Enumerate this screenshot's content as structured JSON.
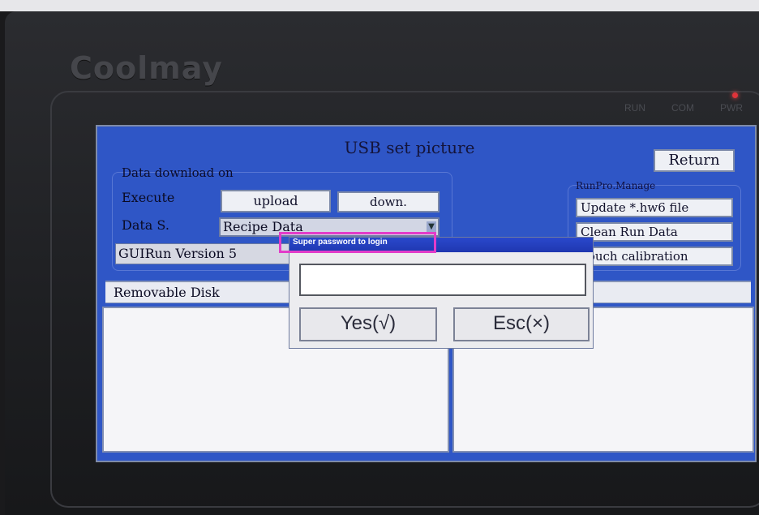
{
  "device": {
    "brand": "Coolmay",
    "leds": [
      "RUN",
      "COM",
      "PWR"
    ]
  },
  "screen": {
    "title": "USB set picture",
    "return_label": "Return",
    "data_group_label": "Data download on",
    "execute_label": "Execute",
    "upload_label": "upload",
    "down_label": "down.",
    "data_source_label": "Data S.",
    "data_source_value": "Recipe Data",
    "version_text": "GUIRun Version 5",
    "runpro": {
      "label": "RunPro.Manage",
      "buttons": [
        "Update *.hw6 file",
        "Clean Run Data",
        "Touch calibration"
      ]
    },
    "disk_label": "Removable Disk"
  },
  "dialog": {
    "title": "Super password to login",
    "input_value": "",
    "yes_label": "Yes(√)",
    "esc_label": "Esc(×)"
  }
}
